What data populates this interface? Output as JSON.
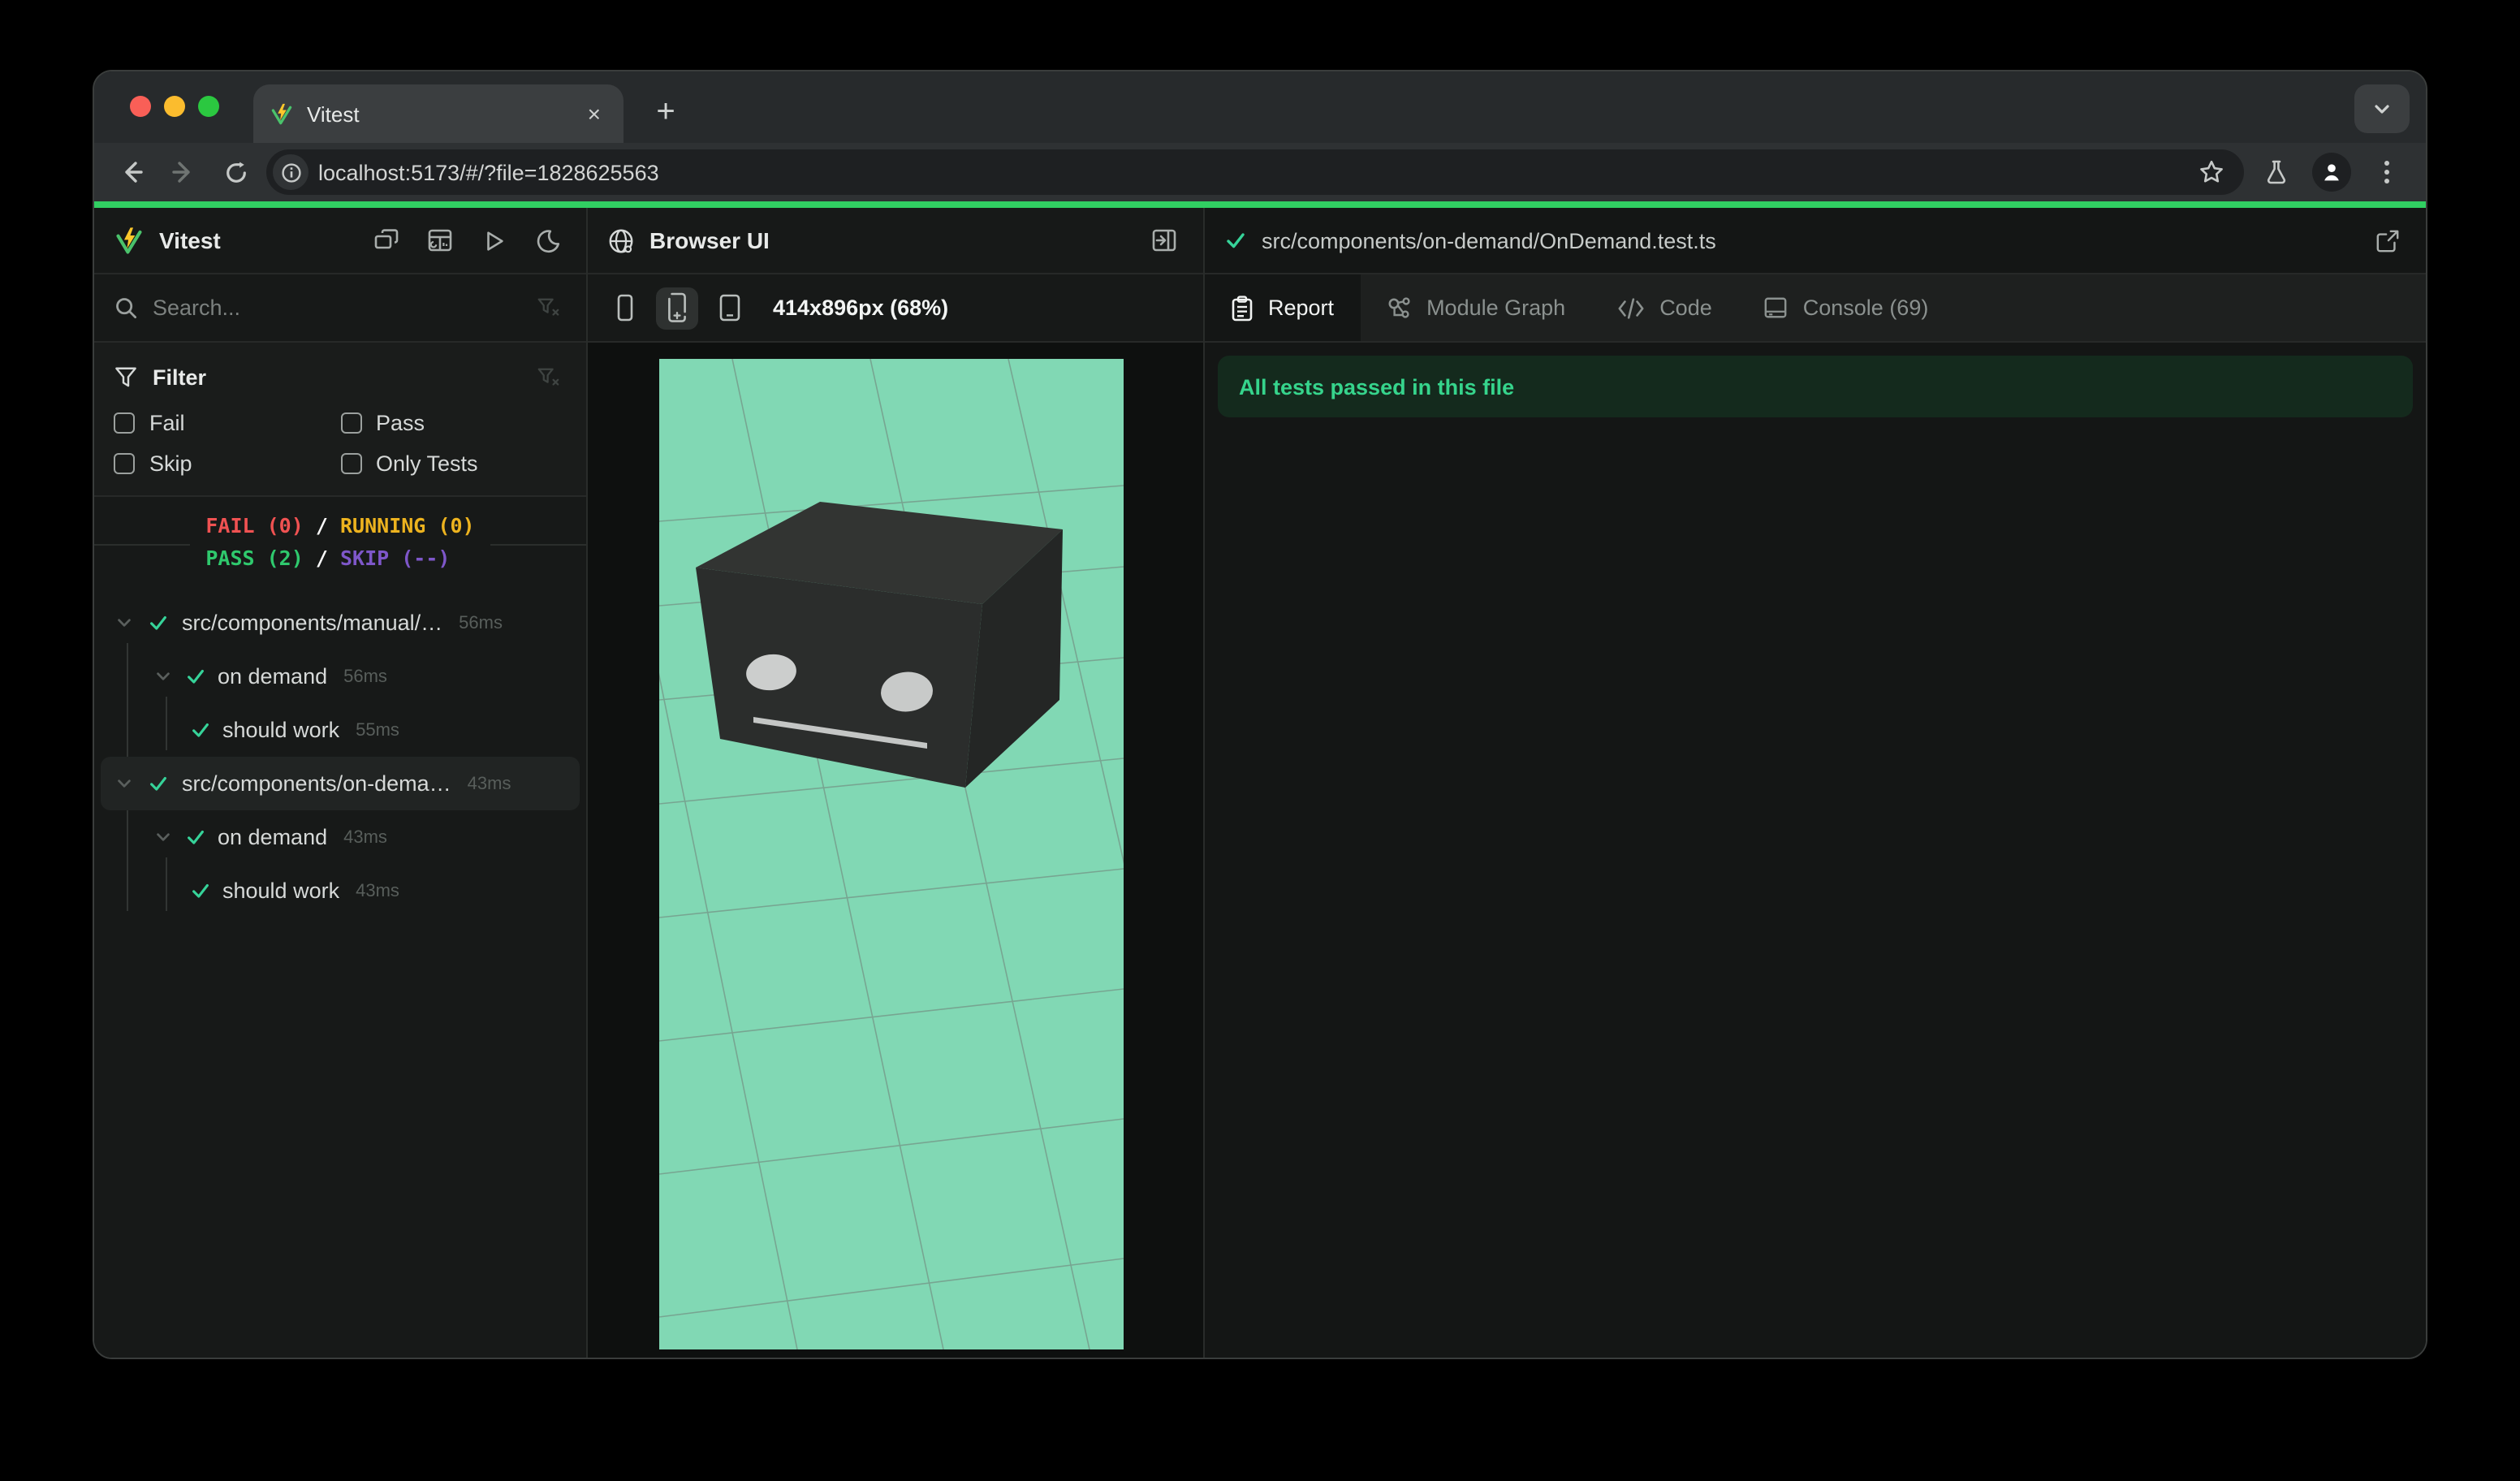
{
  "chrome": {
    "tab_title": "Vitest",
    "close_label": "×",
    "new_tab_label": "+",
    "url": "localhost:5173/#/?file=1828625563"
  },
  "sidebar": {
    "title": "Vitest",
    "search_placeholder": "Search...",
    "filter": {
      "label": "Filter",
      "options": [
        "Fail",
        "Pass",
        "Skip",
        "Only Tests"
      ]
    },
    "summary": {
      "fail": "FAIL (0)",
      "running": "RUNNING (0)",
      "pass": "PASS (2)",
      "skip": "SKIP (--)",
      "separator": "/"
    },
    "tree": [
      {
        "label": "src/components/manual/…",
        "duration": "56ms"
      },
      {
        "label": "on demand",
        "duration": "56ms"
      },
      {
        "label": "should work",
        "duration": "55ms"
      },
      {
        "label": "src/components/on-dema…",
        "duration": "43ms"
      },
      {
        "label": "on demand",
        "duration": "43ms"
      },
      {
        "label": "should work",
        "duration": "43ms"
      }
    ]
  },
  "browser_panel": {
    "title": "Browser UI",
    "viewport_size": "414x896px (68%)"
  },
  "report_panel": {
    "file_path": "src/components/on-demand/OnDemand.test.ts",
    "tabs": [
      {
        "label": "Report"
      },
      {
        "label": "Module Graph"
      },
      {
        "label": "Code"
      },
      {
        "label": "Console (69)"
      }
    ],
    "banner": "All tests passed in this file"
  },
  "colors": {
    "progress_green": "#31cf62",
    "pass_green": "#2fc96d",
    "fail_red": "#f05252",
    "running_yellow": "#edb31f",
    "skip_purple": "#7e57c9",
    "viewport_teal": "#81d8b4",
    "banner_bg": "#142a1d",
    "banner_text": "#36d48c"
  }
}
